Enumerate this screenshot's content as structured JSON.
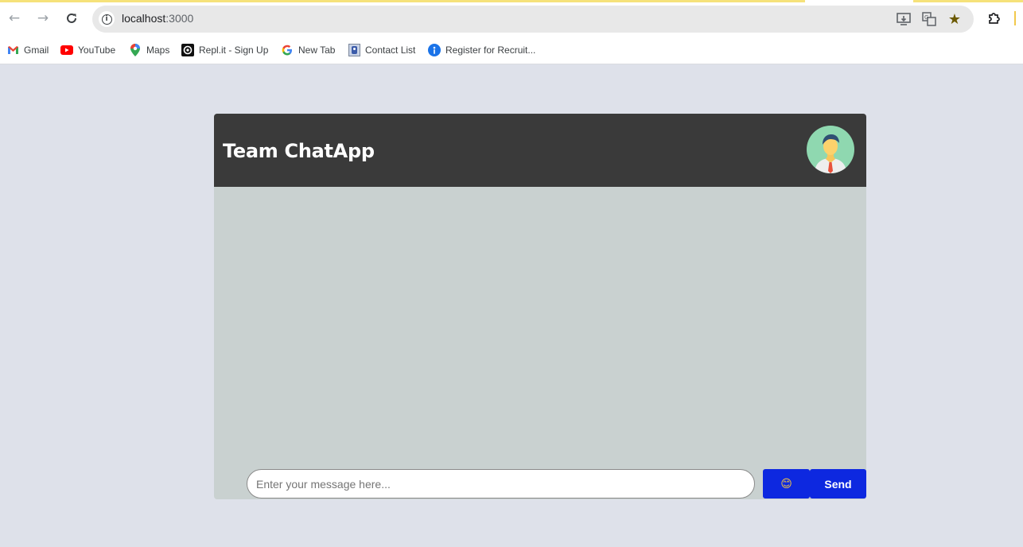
{
  "browser": {
    "url_host": "localhost",
    "url_port": ":3000",
    "bookmarks": [
      {
        "label": "Gmail",
        "icon": "gmail-icon"
      },
      {
        "label": "YouTube",
        "icon": "youtube-icon"
      },
      {
        "label": "Maps",
        "icon": "maps-icon"
      },
      {
        "label": "Repl.it - Sign Up",
        "icon": "replit-icon"
      },
      {
        "label": "New Tab",
        "icon": "google-icon"
      },
      {
        "label": "Contact List",
        "icon": "contact-list-icon"
      },
      {
        "label": "Register for Recruit...",
        "icon": "register-icon"
      }
    ]
  },
  "app": {
    "title": "Team ChatApp",
    "input_placeholder": "Enter your message here...",
    "send_label": "Send",
    "emoji": "😊"
  },
  "colors": {
    "page_bg": "#dee1ea",
    "header_bg": "#3a3a3a",
    "messages_bg": "#c9d1d0",
    "button_bg": "#0d28e0"
  }
}
